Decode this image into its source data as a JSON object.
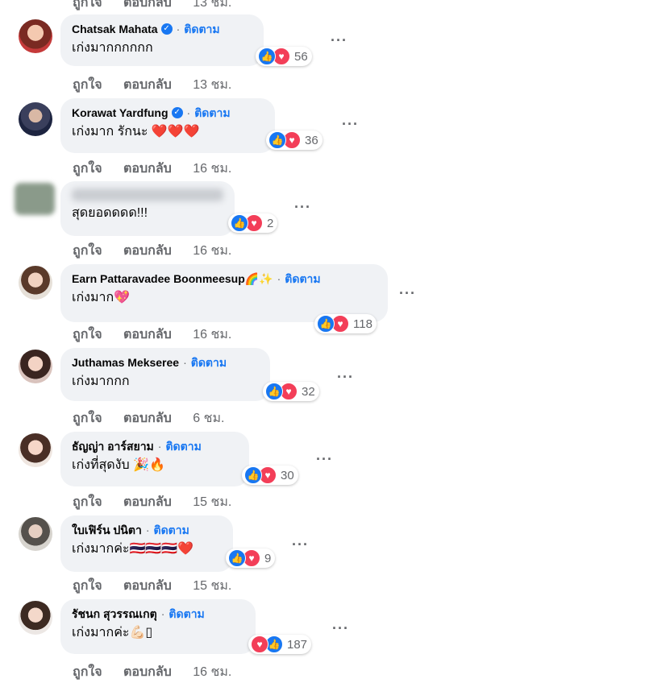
{
  "action_labels": {
    "like": "ถูกใจ",
    "reply": "ตอบกลับ"
  },
  "follow_label": "ติดตาม",
  "top_time": "13 ชม.",
  "comments": [
    {
      "name": "Chatsak Mahata",
      "text": "เก่งมากกกกกก",
      "reactions": "56",
      "time": "13 ชม."
    },
    {
      "name": "Korawat Yardfung",
      "text": "เก่งมาก รักนะ ❤️❤️❤️",
      "reactions": "36",
      "time": "16 ชม."
    },
    {
      "name": "",
      "text": "สุดยอดดดด!!!",
      "reactions": "2",
      "time": "16 ชม."
    },
    {
      "name": "Earn Pattaravadee Boonmeesup🌈✨",
      "text": "เก่งมาก💖",
      "reactions": "118",
      "time": "16 ชม."
    },
    {
      "name": "Juthamas Mekseree",
      "text": "เก่งมากกก",
      "reactions": "32",
      "time": "6 ชม."
    },
    {
      "name": "ธัญญ่า อาร์สยาม",
      "text": "เก่งที่สุดงับ 🎉🔥",
      "reactions": "30",
      "time": "15 ชม."
    },
    {
      "name": "ใบเฟิร์น ปนิตา",
      "text": "เก่งมากค่ะ🇹🇭🇹🇭🇹🇭❤️",
      "reactions": "9",
      "time": "15 ชม."
    },
    {
      "name": "รัชนก สุวรรณเกตุ",
      "text": "เก่งมากค่ะ💪🏻▯",
      "reactions": "187",
      "time": "16 ชม."
    }
  ],
  "icons": {
    "like": "thumbs-up-icon",
    "love": "heart-icon",
    "verified": "verified-badge-icon",
    "more": "more-options-icon"
  },
  "colors": {
    "accent": "#1877f2",
    "love": "#f33e58",
    "bubble": "#f0f2f5",
    "muted": "#65676b"
  }
}
